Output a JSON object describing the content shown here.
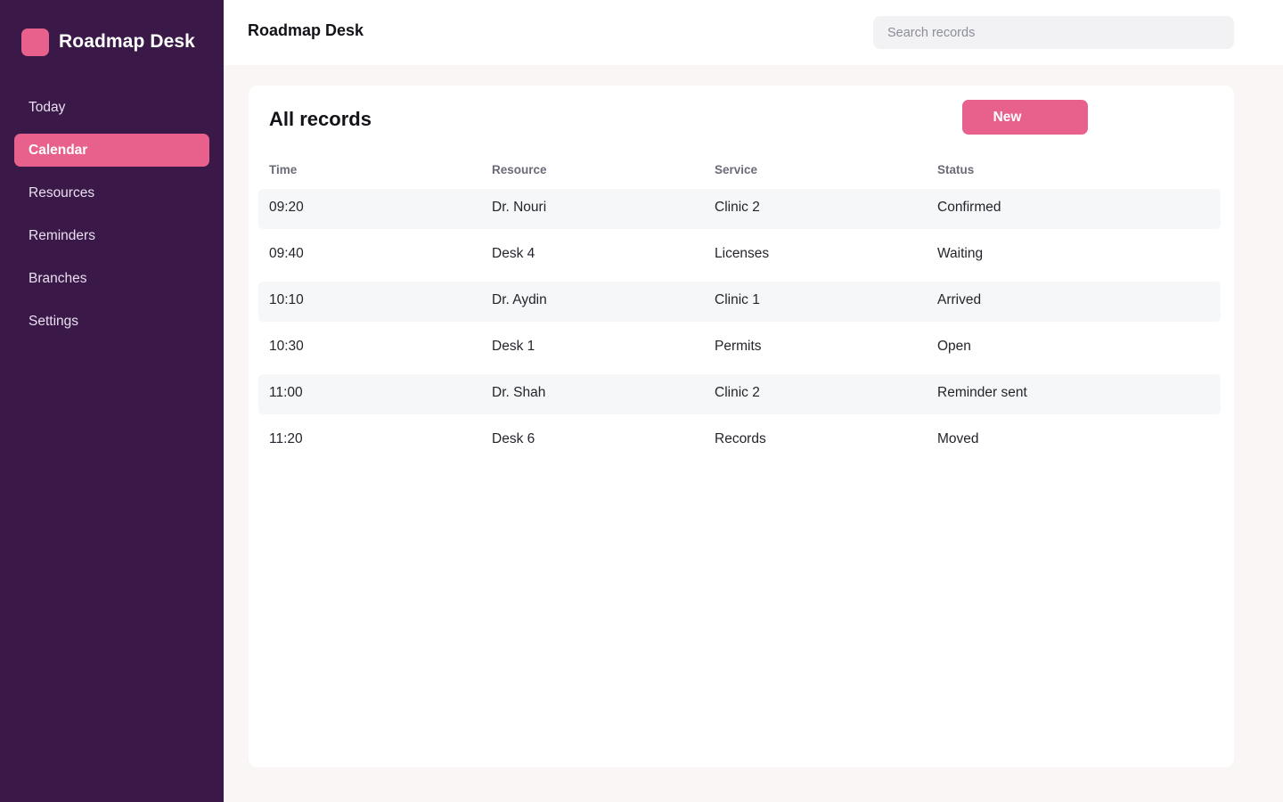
{
  "brand": {
    "name": "Roadmap Desk",
    "logo_color": "#e8618c"
  },
  "sidebar": {
    "items": [
      {
        "label": "Today",
        "active": false
      },
      {
        "label": "Calendar",
        "active": true
      },
      {
        "label": "Resources",
        "active": false
      },
      {
        "label": "Reminders",
        "active": false
      },
      {
        "label": "Branches",
        "active": false
      },
      {
        "label": "Settings",
        "active": false
      }
    ]
  },
  "header": {
    "title": "Roadmap Desk",
    "search_placeholder": "Search records",
    "search_value": ""
  },
  "main": {
    "title": "All records",
    "new_button_label": "New",
    "columns": [
      "Time",
      "Resource",
      "Service",
      "Status"
    ],
    "rows": [
      {
        "time": "09:20",
        "resource": "Dr. Nouri",
        "service": "Clinic 2",
        "status": "Confirmed"
      },
      {
        "time": "09:40",
        "resource": "Desk 4",
        "service": "Licenses",
        "status": "Waiting"
      },
      {
        "time": "10:10",
        "resource": "Dr. Aydin",
        "service": "Clinic 1",
        "status": "Arrived"
      },
      {
        "time": "10:30",
        "resource": "Desk 1",
        "service": "Permits",
        "status": "Open"
      },
      {
        "time": "11:00",
        "resource": "Dr. Shah",
        "service": "Clinic 2",
        "status": "Reminder sent"
      },
      {
        "time": "11:20",
        "resource": "Desk 6",
        "service": "Records",
        "status": "Moved"
      }
    ]
  },
  "colors": {
    "sidebar_bg": "#3a1848",
    "accent": "#e8618c",
    "page_bg": "#fbf6f6",
    "row_shade": "#f6f7f9"
  }
}
